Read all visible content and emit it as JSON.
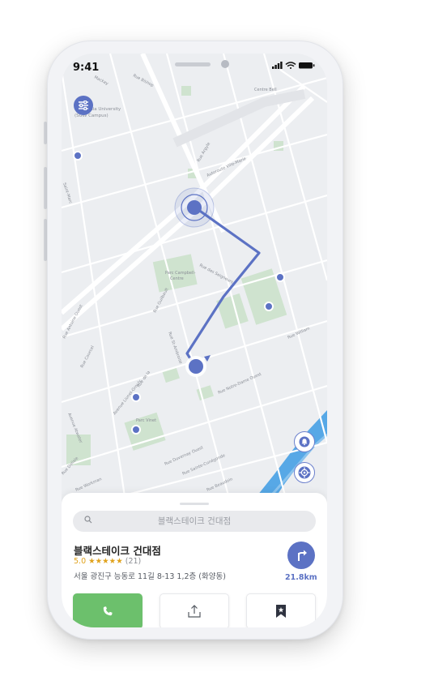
{
  "status_bar": {
    "time": "9:41"
  },
  "map": {
    "labels": {
      "mackay": "Mackay",
      "bishop": "Rue Bishop",
      "centre_bell": "Centre Bell",
      "concordia": "Concordia University",
      "sgw": "(SGW Campus)",
      "argyle": "Rue Argyle",
      "autoroute": "Autoroute Ville-Marie",
      "saint_marc": "Saint-Marc",
      "parc_oscar": "Parc Campbell-",
      "centre_label": "Centre",
      "seigneurs": "Rue des Seigneurs",
      "guilbault": "Rue Guilbault",
      "william": "Rue William",
      "antoine": "Rue Antoine Ouest",
      "courcel": "Rue Courcel",
      "rue_de_la": "Rue de la",
      "notre_dame": "Rue Notre-Dame Ouest",
      "st_ambroise": "Rue St-Ambroise",
      "parc_vinet": "Parc Vinet",
      "atwater": "Avenue Atwater",
      "duvernay": "Rue Duvernay Ouest",
      "sainte_cunegonde": "Rue Sainte-Cunégonde",
      "delisle": "Rue Delisle",
      "workman": "Rue Workman",
      "lionel": "Avenue Lionel-Groulx",
      "beaudoin": "Rue Beaudoin"
    }
  },
  "sheet": {
    "search_placeholder": "블랙스테이크 건대점",
    "place_name": "블랙스테이크 건대점",
    "rating": "5.0 ★★★★★",
    "review_count": "(21)",
    "address": "서울 광진구 능동로 11길 8-13 1,2층 (화양동)",
    "distance": "21.8km"
  },
  "icons": {
    "filter": "sliders-icon",
    "bell": "bell-icon",
    "locate": "crosshair-icon",
    "directions": "turn-right-arrow-icon",
    "call": "phone-icon",
    "share": "share-icon",
    "save": "bookmark-star-icon"
  },
  "colors": {
    "accent": "#5c72c4",
    "call_green": "#6cc06c",
    "rating_gold": "#e0a21c",
    "water": "#57a8e6",
    "park": "#cfe3cf"
  }
}
